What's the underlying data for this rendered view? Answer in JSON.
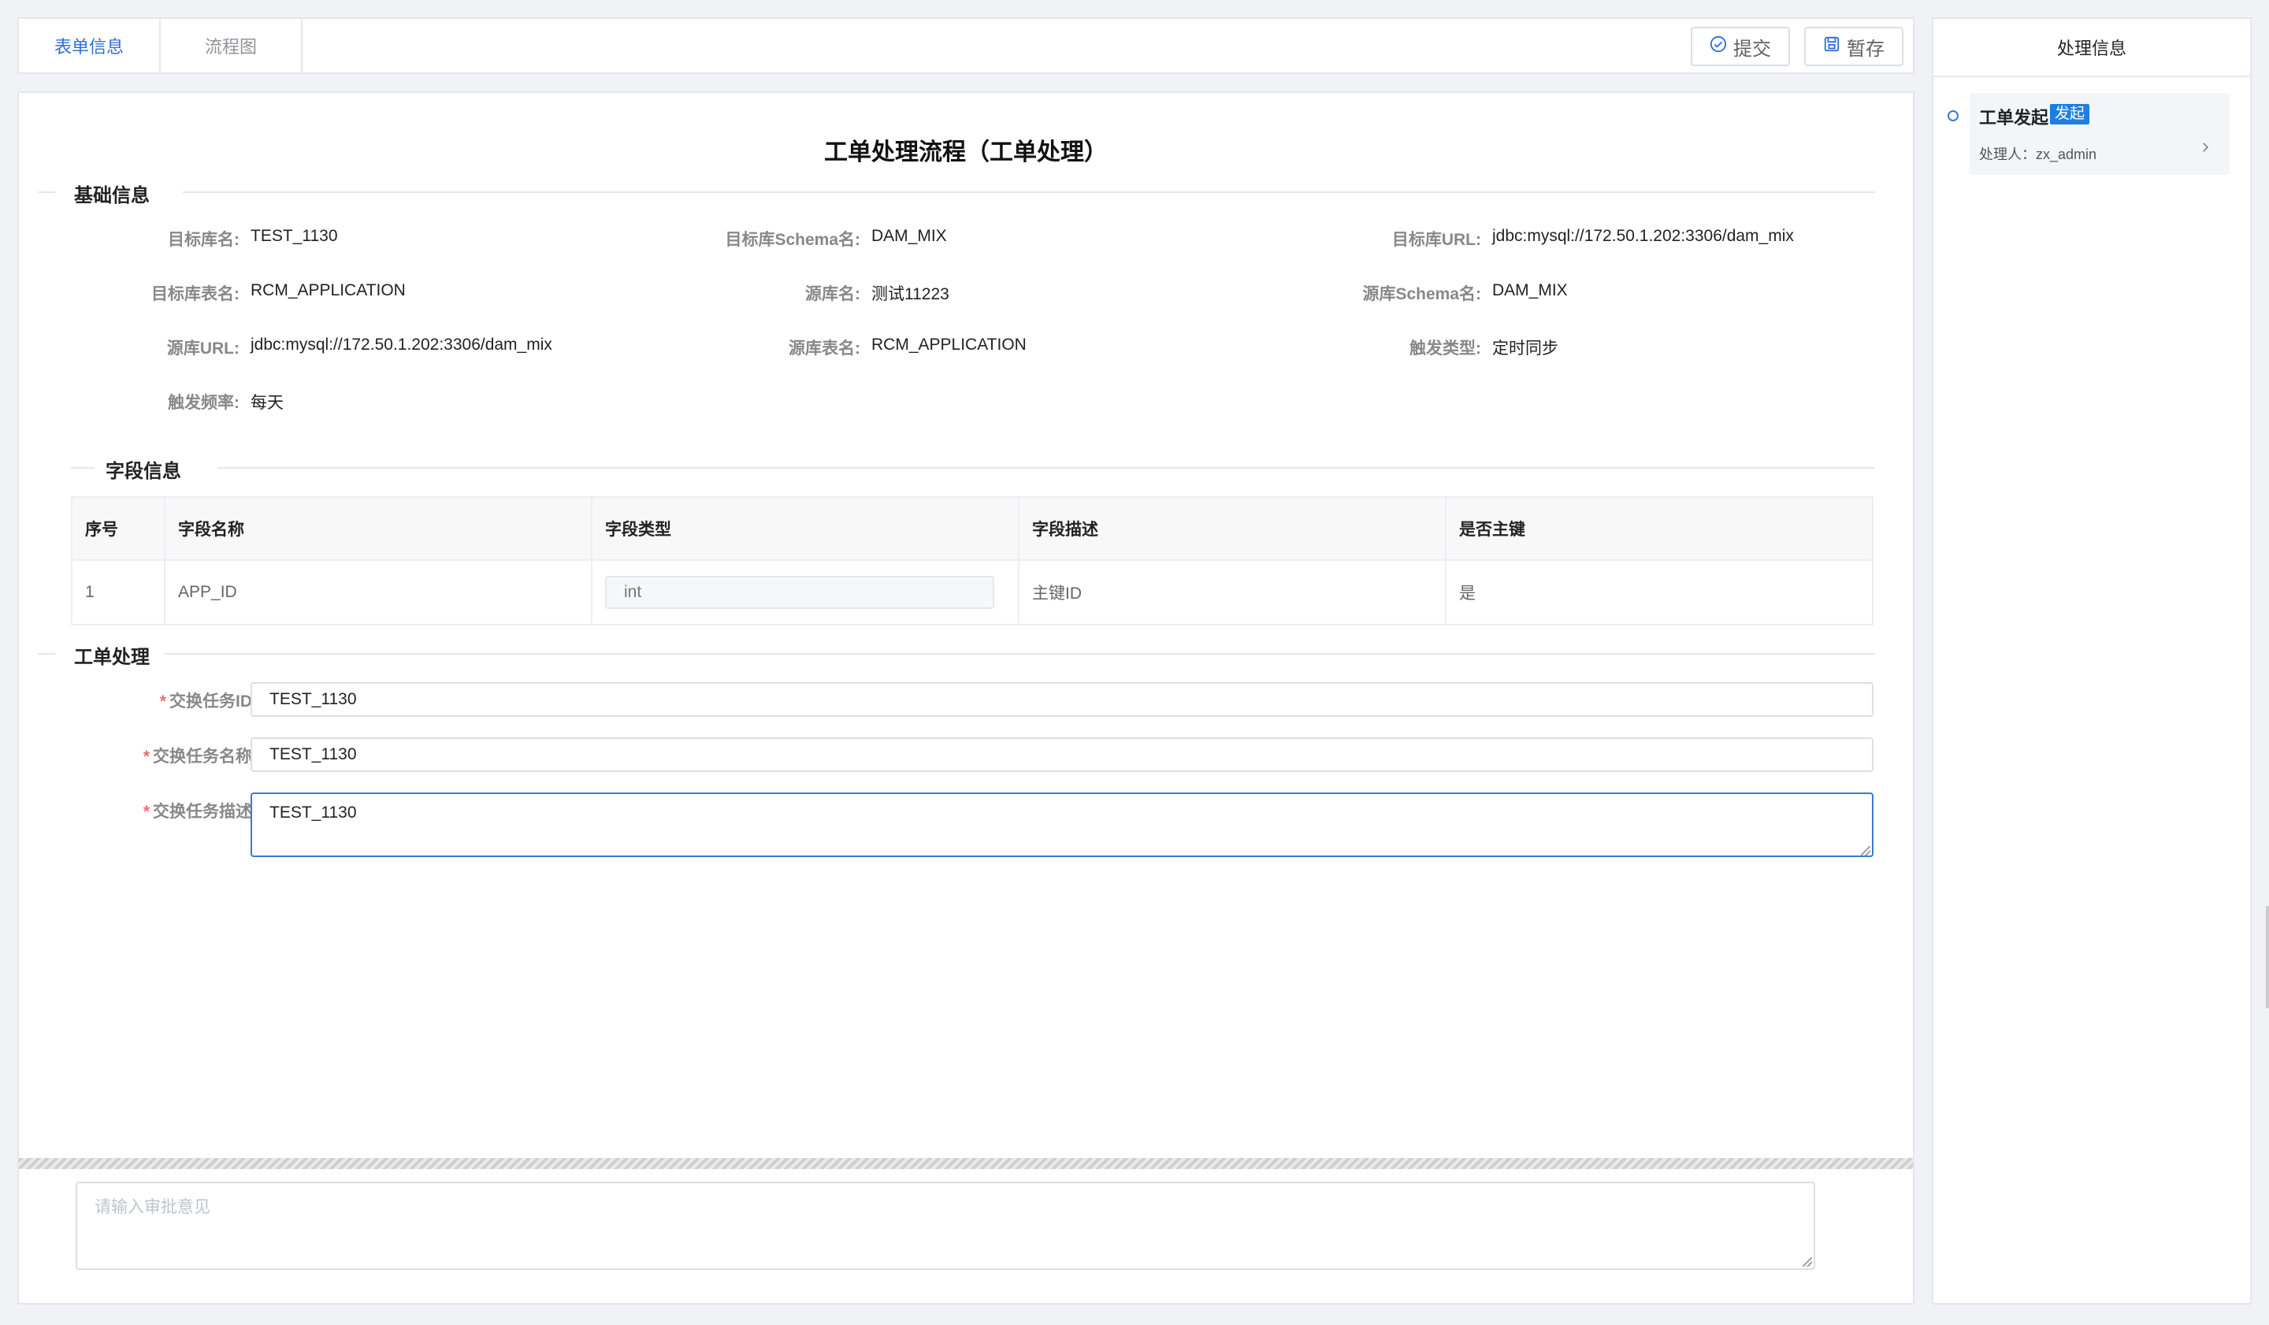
{
  "tabs": [
    {
      "label": "表单信息",
      "active": true
    },
    {
      "label": "流程图",
      "active": false
    }
  ],
  "toolbar": {
    "submit_label": "提交",
    "save_label": "暂存",
    "submit_icon": "check-circle-icon",
    "save_icon": "save-icon"
  },
  "title": "工单处理流程（工单处理）",
  "basic_info": {
    "section_label": "基础信息",
    "fields": [
      {
        "label": "目标库名:",
        "value": "TEST_1130"
      },
      {
        "label": "目标库Schema名:",
        "value": "DAM_MIX"
      },
      {
        "label": "目标库URL:",
        "value": "jdbc:mysql://172.50.1.202:3306/dam_mix"
      },
      {
        "label": "目标库表名:",
        "value": "RCM_APPLICATION"
      },
      {
        "label": "源库名:",
        "value": "测试11223"
      },
      {
        "label": "源库Schema名:",
        "value": "DAM_MIX"
      },
      {
        "label": "源库URL:",
        "value": "jdbc:mysql://172.50.1.202:3306/dam_mix"
      },
      {
        "label": "源库表名:",
        "value": "RCM_APPLICATION"
      },
      {
        "label": "触发类型:",
        "value": "定时同步"
      },
      {
        "label": "触发频率:",
        "value": "每天"
      }
    ]
  },
  "field_info": {
    "section_label": "字段信息",
    "columns": [
      "序号",
      "字段名称",
      "字段类型",
      "字段描述",
      "是否主键"
    ],
    "rows": [
      {
        "index": "1",
        "name": "APP_ID",
        "type": "int",
        "desc": "主键ID",
        "primary": "是"
      }
    ]
  },
  "process": {
    "section_label": "工单处理",
    "task_id_label": "交换任务ID",
    "task_id_value": "TEST_1130",
    "task_name_label": "交换任务名称",
    "task_name_value": "TEST_1130",
    "task_desc_label": "交换任务描述",
    "task_desc_value": "TEST_1130",
    "required_mark": "*"
  },
  "opinion": {
    "placeholder": "请输入审批意见"
  },
  "side": {
    "title": "处理信息",
    "node_title": "工单发起",
    "node_badge": "发起",
    "node_handler": "处理人：zx_admin"
  },
  "colors": {
    "accent": "#2f6fd1",
    "badge": "#1e7fe0",
    "required": "#f56c6c"
  }
}
